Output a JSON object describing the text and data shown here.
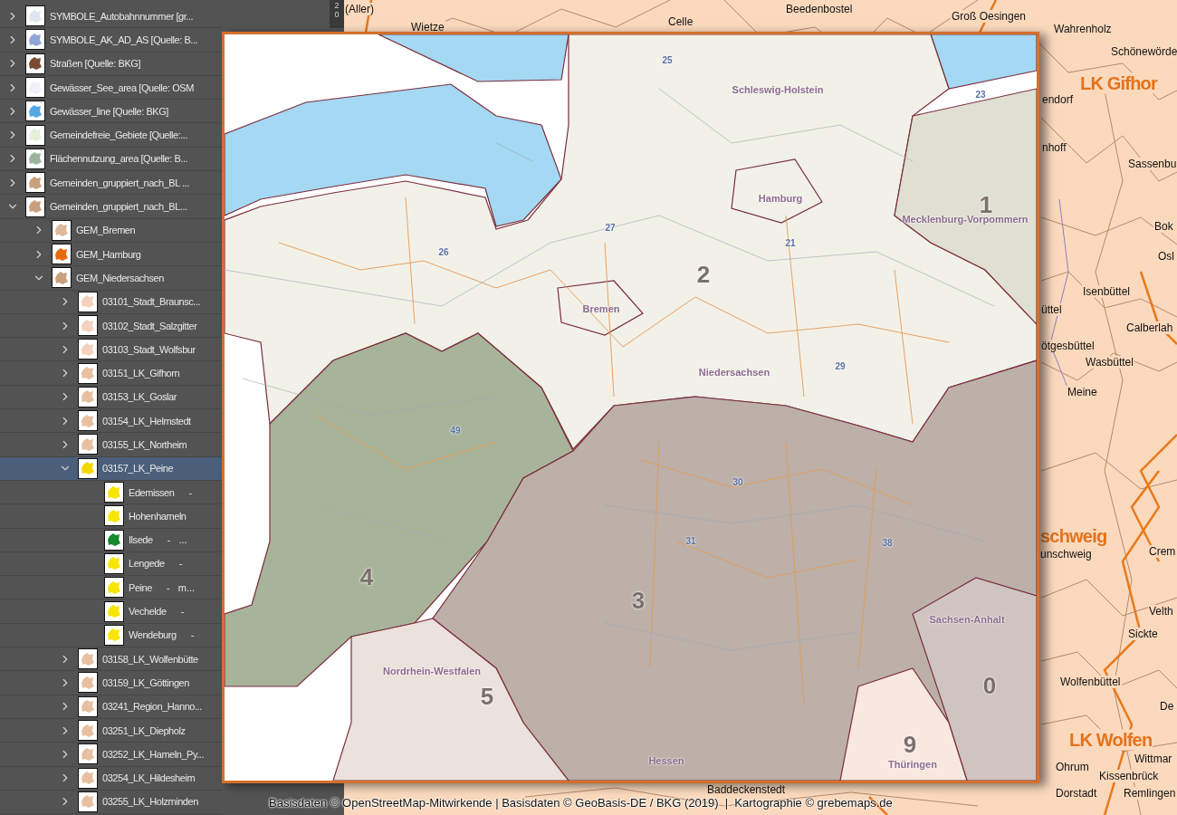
{
  "layers_panel": {
    "ruler_labels": [
      "2",
      "0"
    ],
    "layers": [
      {
        "name": "SYMBOLE_Autobahnnummer [gr...",
        "kind": "group",
        "expanded": false,
        "selected": false,
        "color": "#dfe6f2"
      },
      {
        "name": "SYMBOLE_AK_AD_AS [Quelle: B...",
        "kind": "group",
        "expanded": false,
        "selected": false,
        "color": "#8fa6d6"
      },
      {
        "name": "Straßen [Quelle: BKG]",
        "kind": "group",
        "expanded": false,
        "selected": false,
        "color": "#7a4a33"
      },
      {
        "name": "Gewässer_See_area [Quelle: OSM",
        "kind": "group",
        "expanded": false,
        "selected": false,
        "color": "#eef2f8"
      },
      {
        "name": "Gewässer_line [Quelle: BKG]",
        "kind": "group",
        "expanded": false,
        "selected": false,
        "color": "#55a8e6"
      },
      {
        "name": "Gemeindefreie_Gebiete [Quelle:...",
        "kind": "group",
        "expanded": false,
        "selected": false,
        "color": "#e6efd8"
      },
      {
        "name": "Flächennutzung_area [Quelle: B...",
        "kind": "group",
        "expanded": false,
        "selected": false,
        "color": "#9ab59a"
      },
      {
        "name": "Gemeinden_gruppiert_nach_BL ...",
        "kind": "group",
        "expanded": false,
        "selected": false,
        "color": "#c9a07e"
      },
      {
        "name": "Gemeinden_gruppiert_nach_BL...",
        "kind": "group",
        "expanded": true,
        "selected": false,
        "color": "#c9a07e",
        "children": [
          {
            "name": "GEM_Bremen",
            "kind": "group",
            "expanded": false,
            "selected": false,
            "color": "#e0b89a"
          },
          {
            "name": "GEM_Hamburg",
            "kind": "group",
            "expanded": false,
            "selected": false,
            "color": "#e86a10"
          },
          {
            "name": "GEM_Niedersachsen",
            "kind": "group",
            "expanded": true,
            "selected": false,
            "color": "#c9a07e",
            "children": [
              {
                "name": "03101_Stadt_Braunsc...",
                "kind": "group",
                "expanded": false,
                "selected": false,
                "color": "#f3d3bf"
              },
              {
                "name": "03102_Stadt_Salzgitter",
                "kind": "group",
                "expanded": false,
                "selected": false,
                "color": "#f3d3bf"
              },
              {
                "name": "03103_Stadt_Wolfsbur",
                "kind": "group",
                "expanded": false,
                "selected": false,
                "color": "#f3d3bf"
              },
              {
                "name": "03151_LK_Gifhorn",
                "kind": "group",
                "expanded": false,
                "selected": false,
                "color": "#e8c0a0"
              },
              {
                "name": "03153_LK_Goslar",
                "kind": "group",
                "expanded": false,
                "selected": false,
                "color": "#e8c0a0"
              },
              {
                "name": "03154_LK_Helmstedt",
                "kind": "group",
                "expanded": false,
                "selected": false,
                "color": "#e8c0a0"
              },
              {
                "name": "03155_LK_Northeim",
                "kind": "group",
                "expanded": false,
                "selected": false,
                "color": "#e8c0a0"
              },
              {
                "name": "03157_LK_Peine",
                "kind": "group",
                "expanded": true,
                "selected": true,
                "color": "#f2d800",
                "children": [
                  {
                    "name": "Edemissen",
                    "suffix": "-",
                    "kind": "item",
                    "selected": false,
                    "color": "#f7e600"
                  },
                  {
                    "name": "Hohenhameln",
                    "kind": "item",
                    "selected": false,
                    "color": "#f7e600"
                  },
                  {
                    "name": "Ilsede",
                    "suffix": "-   ...",
                    "kind": "item",
                    "selected": false,
                    "color": "#138a2e"
                  },
                  {
                    "name": "Lengede",
                    "suffix": "-",
                    "kind": "item",
                    "selected": false,
                    "color": "#f7e600"
                  },
                  {
                    "name": "Peine",
                    "suffix": "-   m...",
                    "kind": "item",
                    "selected": false,
                    "color": "#f7e600"
                  },
                  {
                    "name": "Vechelde",
                    "suffix": "-",
                    "kind": "item",
                    "selected": false,
                    "color": "#f7e600"
                  },
                  {
                    "name": "Wendeburg",
                    "suffix": "-",
                    "kind": "item",
                    "selected": false,
                    "color": "#f7e600"
                  }
                ]
              },
              {
                "name": "03158_LK_Wolfenbütte",
                "kind": "group",
                "expanded": false,
                "selected": false,
                "color": "#e8c0a0"
              },
              {
                "name": "03159_LK_Göttingen",
                "kind": "group",
                "expanded": false,
                "selected": false,
                "color": "#e8c0a0"
              },
              {
                "name": "03241_Region_Hanno...",
                "kind": "group",
                "expanded": false,
                "selected": false,
                "color": "#e8c0a0"
              },
              {
                "name": "03251_LK_Diepholz",
                "kind": "group",
                "expanded": false,
                "selected": false,
                "color": "#e8c0a0"
              },
              {
                "name": "03252_LK_Hameln_Py...",
                "kind": "group",
                "expanded": false,
                "selected": false,
                "color": "#e8c0a0"
              },
              {
                "name": "03254_LK_Hildesheim",
                "kind": "group",
                "expanded": false,
                "selected": false,
                "color": "#e8c0a0"
              },
              {
                "name": "03255_LK_Holzminden",
                "kind": "group",
                "expanded": false,
                "selected": false,
                "color": "#e8c0a0"
              }
            ]
          }
        ]
      }
    ]
  },
  "background_map": {
    "places": [
      {
        "name": "(Aller)",
        "kind": "town"
      },
      {
        "name": "Wietze",
        "kind": "town"
      },
      {
        "name": "Celle",
        "kind": "town"
      },
      {
        "name": "Beedenbostel",
        "kind": "town"
      },
      {
        "name": "Groß Oesingen",
        "kind": "town"
      },
      {
        "name": "Wahrenholz",
        "kind": "town"
      },
      {
        "name": "Schönewörde",
        "kind": "town"
      },
      {
        "name": "LK Gifhor",
        "kind": "district"
      },
      {
        "name": "endorf",
        "kind": "town"
      },
      {
        "name": "nhoff",
        "kind": "town"
      },
      {
        "name": "Sassenbu",
        "kind": "town"
      },
      {
        "name": "Bok",
        "kind": "town"
      },
      {
        "name": "Osl",
        "kind": "town"
      },
      {
        "name": "Isenbüttel",
        "kind": "town"
      },
      {
        "name": "üttel",
        "kind": "town"
      },
      {
        "name": "Calberlah",
        "kind": "town"
      },
      {
        "name": "ötgesbüttel",
        "kind": "town"
      },
      {
        "name": "Wasbüttel",
        "kind": "town"
      },
      {
        "name": "Meine",
        "kind": "town"
      },
      {
        "name": "schweig",
        "kind": "district"
      },
      {
        "name": "unschweig",
        "kind": "town"
      },
      {
        "name": "Crem",
        "kind": "town"
      },
      {
        "name": "Velth",
        "kind": "town"
      },
      {
        "name": "Sickte",
        "kind": "town"
      },
      {
        "name": "Wolfenbüttel",
        "kind": "town"
      },
      {
        "name": "De",
        "kind": "town"
      },
      {
        "name": "LK Wolfen",
        "kind": "district"
      },
      {
        "name": "Wittmar",
        "kind": "town"
      },
      {
        "name": "Ohrum",
        "kind": "town"
      },
      {
        "name": "Kissenbrück",
        "kind": "town"
      },
      {
        "name": "Dorstadt",
        "kind": "town"
      },
      {
        "name": "Remlingen",
        "kind": "town"
      },
      {
        "name": "Baddeckenstedt",
        "kind": "town"
      }
    ]
  },
  "inset_map": {
    "labels": [
      {
        "text": "25",
        "kind": "code"
      },
      {
        "text": "Schleswig-Holstein",
        "kind": "state"
      },
      {
        "text": "23",
        "kind": "code"
      },
      {
        "text": "Hamburg",
        "kind": "state"
      },
      {
        "text": "1",
        "kind": "zone"
      },
      {
        "text": "Mecklenburg-Vorpommern",
        "kind": "state"
      },
      {
        "text": "27",
        "kind": "code"
      },
      {
        "text": "21",
        "kind": "code"
      },
      {
        "text": "26",
        "kind": "code"
      },
      {
        "text": "2",
        "kind": "zone"
      },
      {
        "text": "Bremen",
        "kind": "state"
      },
      {
        "text": "Niedersachsen",
        "kind": "state"
      },
      {
        "text": "29",
        "kind": "code"
      },
      {
        "text": "49",
        "kind": "code"
      },
      {
        "text": "30",
        "kind": "code"
      },
      {
        "text": "31",
        "kind": "code"
      },
      {
        "text": "38",
        "kind": "code"
      },
      {
        "text": "4",
        "kind": "zone"
      },
      {
        "text": "3",
        "kind": "zone"
      },
      {
        "text": "Sachsen-Anhalt",
        "kind": "state"
      },
      {
        "text": "Nordrhein-Westfalen",
        "kind": "state"
      },
      {
        "text": "5",
        "kind": "zone"
      },
      {
        "text": "0",
        "kind": "zone"
      },
      {
        "text": "9",
        "kind": "zone"
      },
      {
        "text": "Hessen",
        "kind": "state"
      },
      {
        "text": "Thüringen",
        "kind": "state"
      }
    ]
  },
  "credits": "Basisdaten © OpenStreetMap-Mitwirkende | Basisdaten © GeoBasis-DE / BKG (2019)  |  Kartographie © grebemaps.de"
}
